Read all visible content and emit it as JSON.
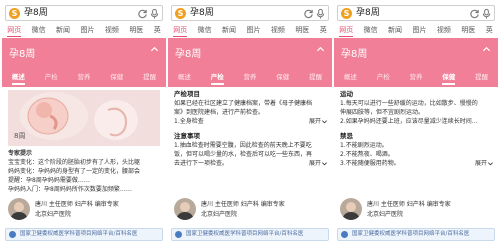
{
  "search": {
    "logo_char": "S",
    "query": "孕8周"
  },
  "nav": [
    "网页",
    "微信",
    "新闻",
    "图片",
    "视频",
    "明医",
    "英"
  ],
  "banner_title": "孕8周",
  "subtabs": [
    "概述",
    "产检",
    "营养",
    "保健",
    "提醒"
  ],
  "accent_color": "#f07f97",
  "active_color": "#e35070",
  "panel1": {
    "image_label": "8周",
    "tip_title": "专家提示",
    "tip_lines": [
      "宝宝变化：这个阶段的胚胎初步有了人形，头比躯",
      "妈妈变化：孕妈妈的身型有了一定的变化，腰部会",
      "提醒：孕8周孕妈妈需要做……",
      "孕妈妈入门：孕8周妈妈所作次数要加频繁……"
    ]
  },
  "panel2": {
    "sec1_title": "产检项目",
    "sec1_lines": [
      "如果已经在社区建立了健康档案，带着《母子健康档",
      "案》到医院建档，进行产前检查。",
      "1.全身检查"
    ],
    "sec2_title": "注意事项",
    "sec2_lines": [
      "1.抽血检查时需要空腹，因此检查的前天晚上不要吃",
      "饭，但可以喝少量的水，检查后可以吃一些东西，再",
      "去进行下一项检查。"
    ]
  },
  "panel3": {
    "sec1_title": "运动",
    "sec1_lines": [
      "1.每天可以进行一些舒缓的运动，比如散步、慢慢的",
      "伸展四肢等，但不宜剧烈运动。",
      "2.如果孕妈妈还要上班，应该尽量减少连续长时间…"
    ],
    "sec2_title": "禁忌",
    "sec2_lines": [
      "1.不能剧烈运动。",
      "2.不能熬夜、喝酒。",
      "3.不能随便服用药物。"
    ]
  },
  "expand_label": "展开",
  "author": {
    "line1": "唐川  主任医师 妇产科 编审专家",
    "line2": "北京妇产医院"
  },
  "footer": "国家卫健委权威医学科普项目网络平台/百科名医"
}
